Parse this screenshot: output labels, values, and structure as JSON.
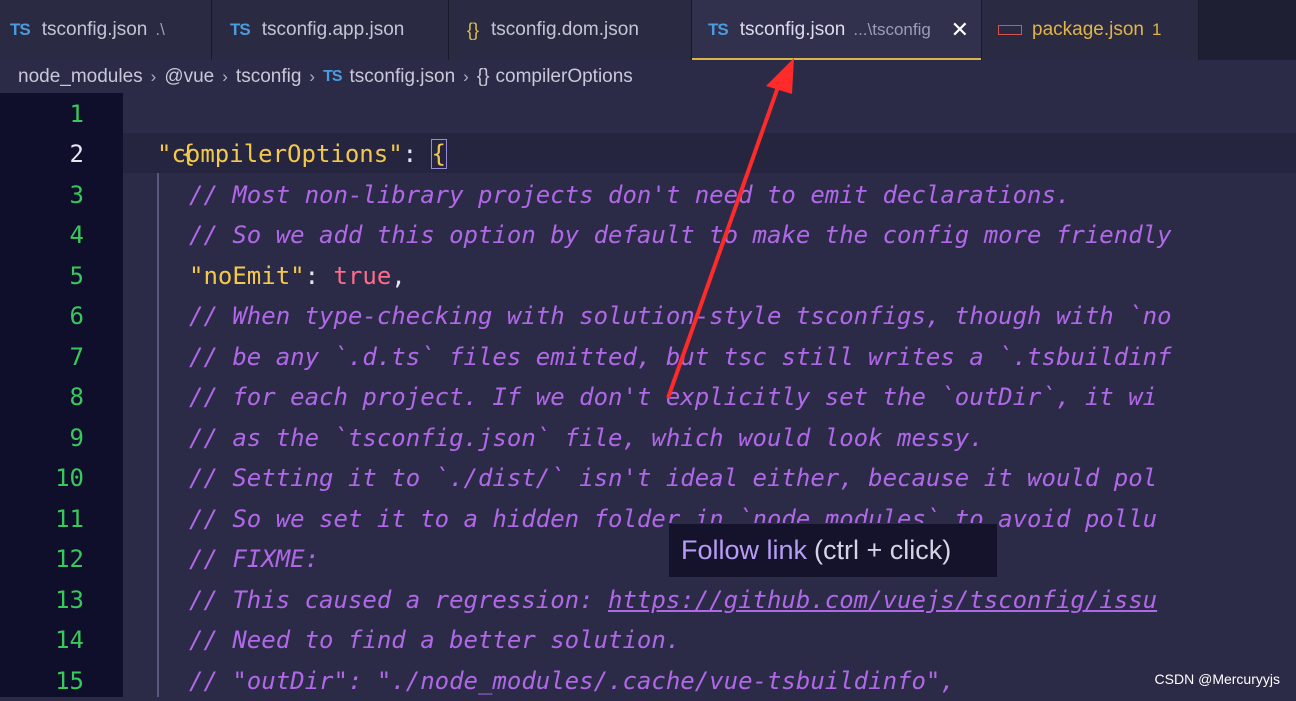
{
  "tabs": [
    {
      "icon": "TS",
      "label": "tsconfig.json",
      "path": ".\\"
    },
    {
      "icon": "TS",
      "label": "tsconfig.app.json"
    },
    {
      "icon": "{}",
      "label": "tsconfig.dom.json"
    },
    {
      "icon": "TS",
      "label": "tsconfig.json",
      "path": "...\\tsconfig",
      "close": "✕"
    },
    {
      "label": "package.json",
      "count": "1"
    }
  ],
  "breadcrumb": {
    "items": [
      "node_modules",
      "@vue",
      "tsconfig",
      "tsconfig.json",
      "compilerOptions"
    ],
    "icon_ts": "TS",
    "icon_obj": "{}",
    "sep": "›"
  },
  "editor": {
    "line_numbers": [
      "1",
      "2",
      "3",
      "4",
      "5",
      "6",
      "7",
      "8",
      "9",
      "10",
      "11",
      "12",
      "13",
      "14",
      "15"
    ],
    "lines": {
      "l1": "{",
      "l2_key": "\"compilerOptions\"",
      "l2_colon": ": ",
      "l2_brace": "{",
      "l3": "// Most non-library projects don't need to emit declarations.",
      "l4": "// So we add this option by default to make the config more friendly",
      "l5_key": "\"noEmit\"",
      "l5_colon": ": ",
      "l5_val": "true",
      "l5_comma": ",",
      "l6": "// When type-checking with solution-style tsconfigs, though with `no",
      "l7": "// be any `.d.ts` files emitted, but tsc still writes a `.tsbuildinf",
      "l8": "// for each project. If we don't explicitly set the `outDir`, it wi",
      "l9": "// as the `tsconfig.json` file, which would look messy.",
      "l10": "// Setting it to `./dist/` isn't ideal either, because it would pol",
      "l11": "// So we set it to a hidden folder in `node_modules` to avoid pollu",
      "l12": "// FIXME:",
      "l13_pre": "// This caused a regression: ",
      "l13_link": "https://github.com/vuejs/tsconfig/issu",
      "l14": "// Need to find a better solution.",
      "l15": "// \"outDir\": \"./node_modules/.cache/vue-tsbuildinfo\","
    }
  },
  "tooltip": {
    "action": "Follow link",
    "shortcut": "(ctrl + click)"
  },
  "watermark": "CSDN @Mercuryyjs",
  "colors": {
    "annotation_arrow": "#ff2a2a",
    "line_numbers": "#37c95b",
    "comment": "#b168e8"
  }
}
